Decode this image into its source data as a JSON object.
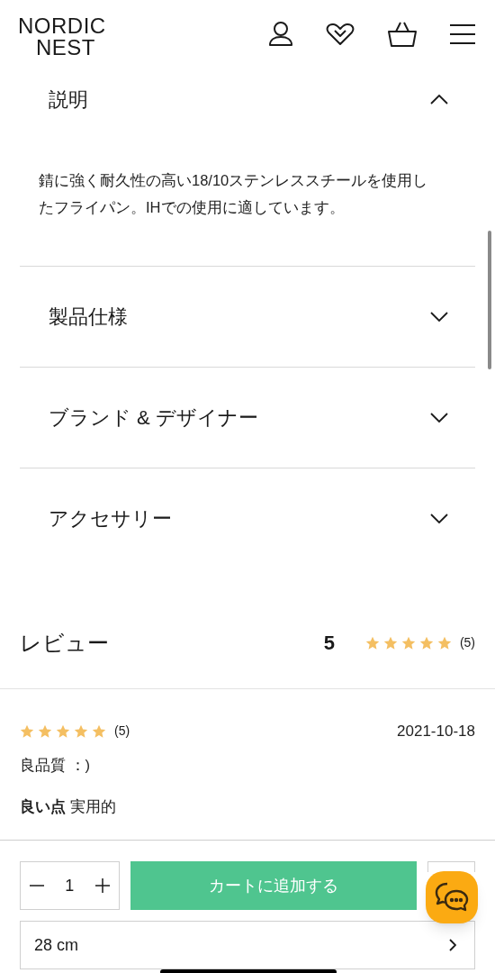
{
  "header": {
    "logo_lines": [
      "NORDIC",
      "NEST"
    ]
  },
  "accordion": [
    {
      "title": "説明",
      "expanded": true,
      "body": "錆に強く耐久性の高い18/10ステンレススチールを使用したフライパン。IHでの使用に適しています。"
    },
    {
      "title": "製品仕様",
      "expanded": false
    },
    {
      "title": "ブランド & デザイナー",
      "expanded": false
    },
    {
      "title": "アクセサリー",
      "expanded": false
    }
  ],
  "reviews": {
    "title": "レビュー",
    "average": "5",
    "stars": 5,
    "count": "(5)",
    "items": [
      {
        "stars": 5,
        "count": "(5)",
        "date": "2021-10-18",
        "headline": "良品質 ：)",
        "pros": "**良い点** 実用的"
      }
    ]
  },
  "purchase_bar": {
    "quantity": "1",
    "add_to_cart": "カートに追加する",
    "variant": "28 cm"
  }
}
